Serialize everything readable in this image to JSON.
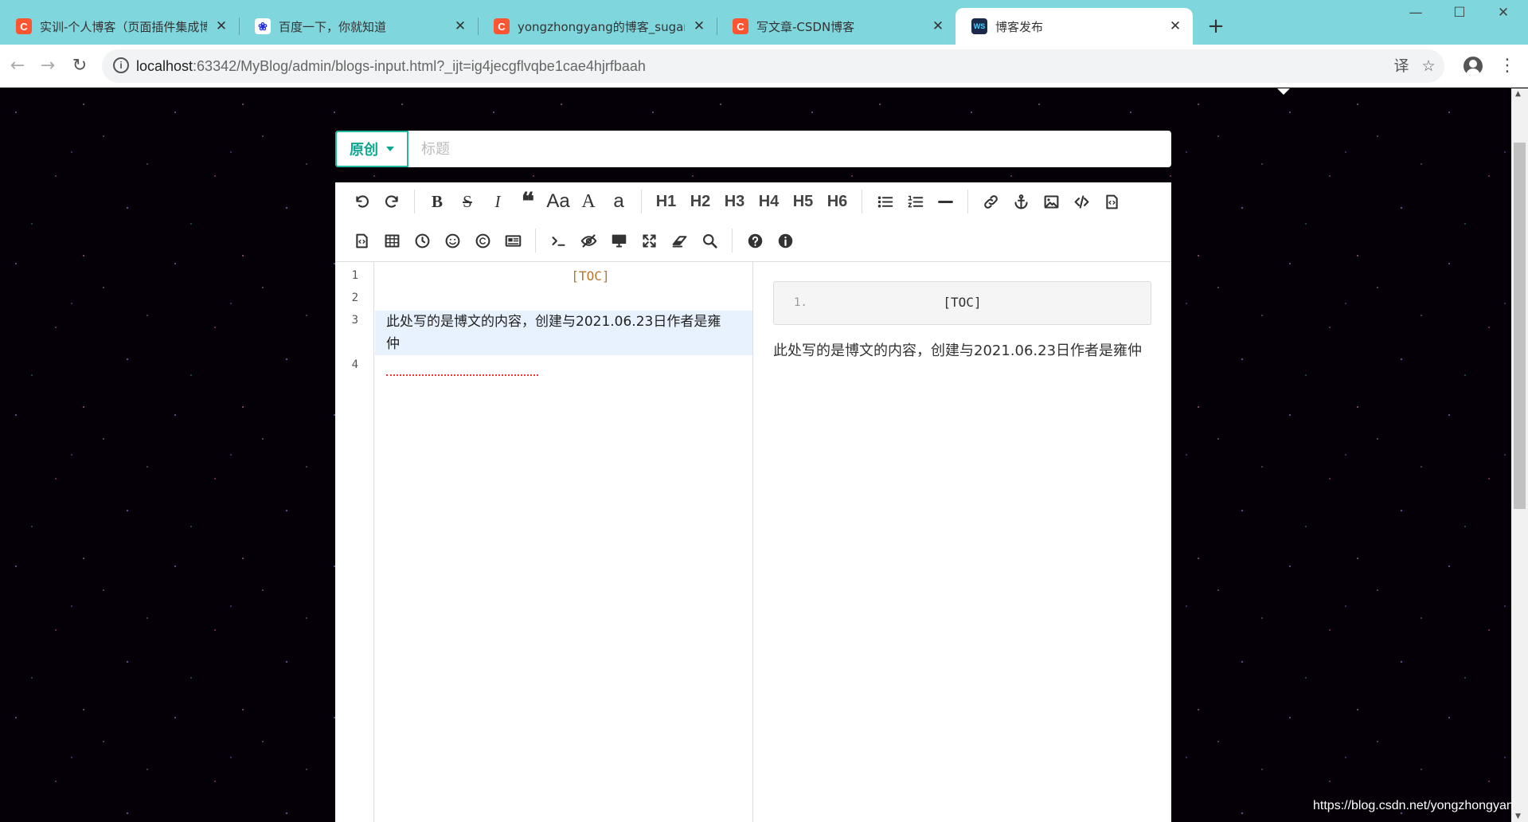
{
  "browser": {
    "tabs": [
      {
        "title": "实训-个人博客（页面插件集成博",
        "favicon": "csdn-c",
        "active": false
      },
      {
        "title": "百度一下，你就知道",
        "favicon": "baidu-paw",
        "active": false
      },
      {
        "title": "yongzhongyang的博客_sugar-l",
        "favicon": "csdn-c",
        "active": false
      },
      {
        "title": "写文章-CSDN博客",
        "favicon": "csdn-c",
        "active": false
      },
      {
        "title": "博客发布",
        "favicon": "webstorm-ws",
        "active": true
      }
    ],
    "new_tab": "+",
    "url_host": "localhost",
    "url_rest": ":63342/MyBlog/admin/blogs-input.html?_ijt=ig4jecgflvqbe1cae4hjrfbaah",
    "icons": [
      "back-icon",
      "forward-icon",
      "reload-icon",
      "info-icon",
      "translate-icon",
      "star-icon",
      "avatar-icon",
      "menu-icon"
    ]
  },
  "form": {
    "type_label": "原创",
    "title_placeholder": "标题",
    "title_value": ""
  },
  "editor": {
    "toolbar_row1": [
      "undo",
      "redo",
      "bold",
      "strikethrough",
      "italic",
      "quote",
      "uppercase",
      "A",
      "a",
      "H1",
      "H2",
      "H3",
      "H4",
      "H5",
      "H6",
      "list-ul",
      "list-ol",
      "hr",
      "link",
      "anchor",
      "image",
      "code",
      "code-block"
    ],
    "headings": [
      "H1",
      "H2",
      "H3",
      "H4",
      "H5",
      "H6"
    ],
    "case_labels": {
      "uppercase": "Aa",
      "upper": "A",
      "lower": "a"
    },
    "line_numbers": [
      "1",
      "2",
      "3",
      "4"
    ],
    "lines": [
      "[TOC]",
      "",
      "此处写的是博文的内容，创建与2021.06.23日作者是雍",
      "仲"
    ],
    "preview": {
      "code_line_number": "1.",
      "code_text": "[TOC]",
      "paragraph": "此处写的是博文的内容，创建与2021.06.23日作者是雍仲"
    }
  },
  "watermark": "https://blog.csdn.net/yongzhongyan",
  "colors": {
    "tabbar": "#7fd6dc",
    "accent": "#0da68f",
    "active_line": "#e8f2fe",
    "toc_code": "#b3782a"
  }
}
